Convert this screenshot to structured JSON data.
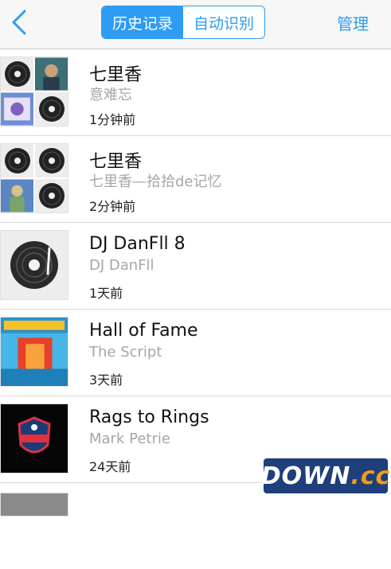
{
  "header": {
    "back_icon": "chevron-left-icon",
    "tabs": [
      {
        "label": "历史记录",
        "active": true
      },
      {
        "label": "自动识别",
        "active": false
      }
    ],
    "manage_label": "管理",
    "accent_color": "#2e9cf2"
  },
  "history": [
    {
      "title": "七里香",
      "subtitle": "意难忘",
      "time": "1分钟前"
    },
    {
      "title": "七里香",
      "subtitle": "七里香—拾拾de记忆",
      "time": "2分钟前"
    },
    {
      "title": "DJ DanFll 8",
      "subtitle": "DJ DanFll",
      "time": "1天前"
    },
    {
      "title": "Hall of Fame",
      "subtitle": "The Script",
      "time": "3天前"
    },
    {
      "title": "Rags to Rings",
      "subtitle": "Mark Petrie",
      "time": "24天前"
    }
  ],
  "watermark": {
    "text": "DOWN",
    "suffix": ".cc"
  }
}
